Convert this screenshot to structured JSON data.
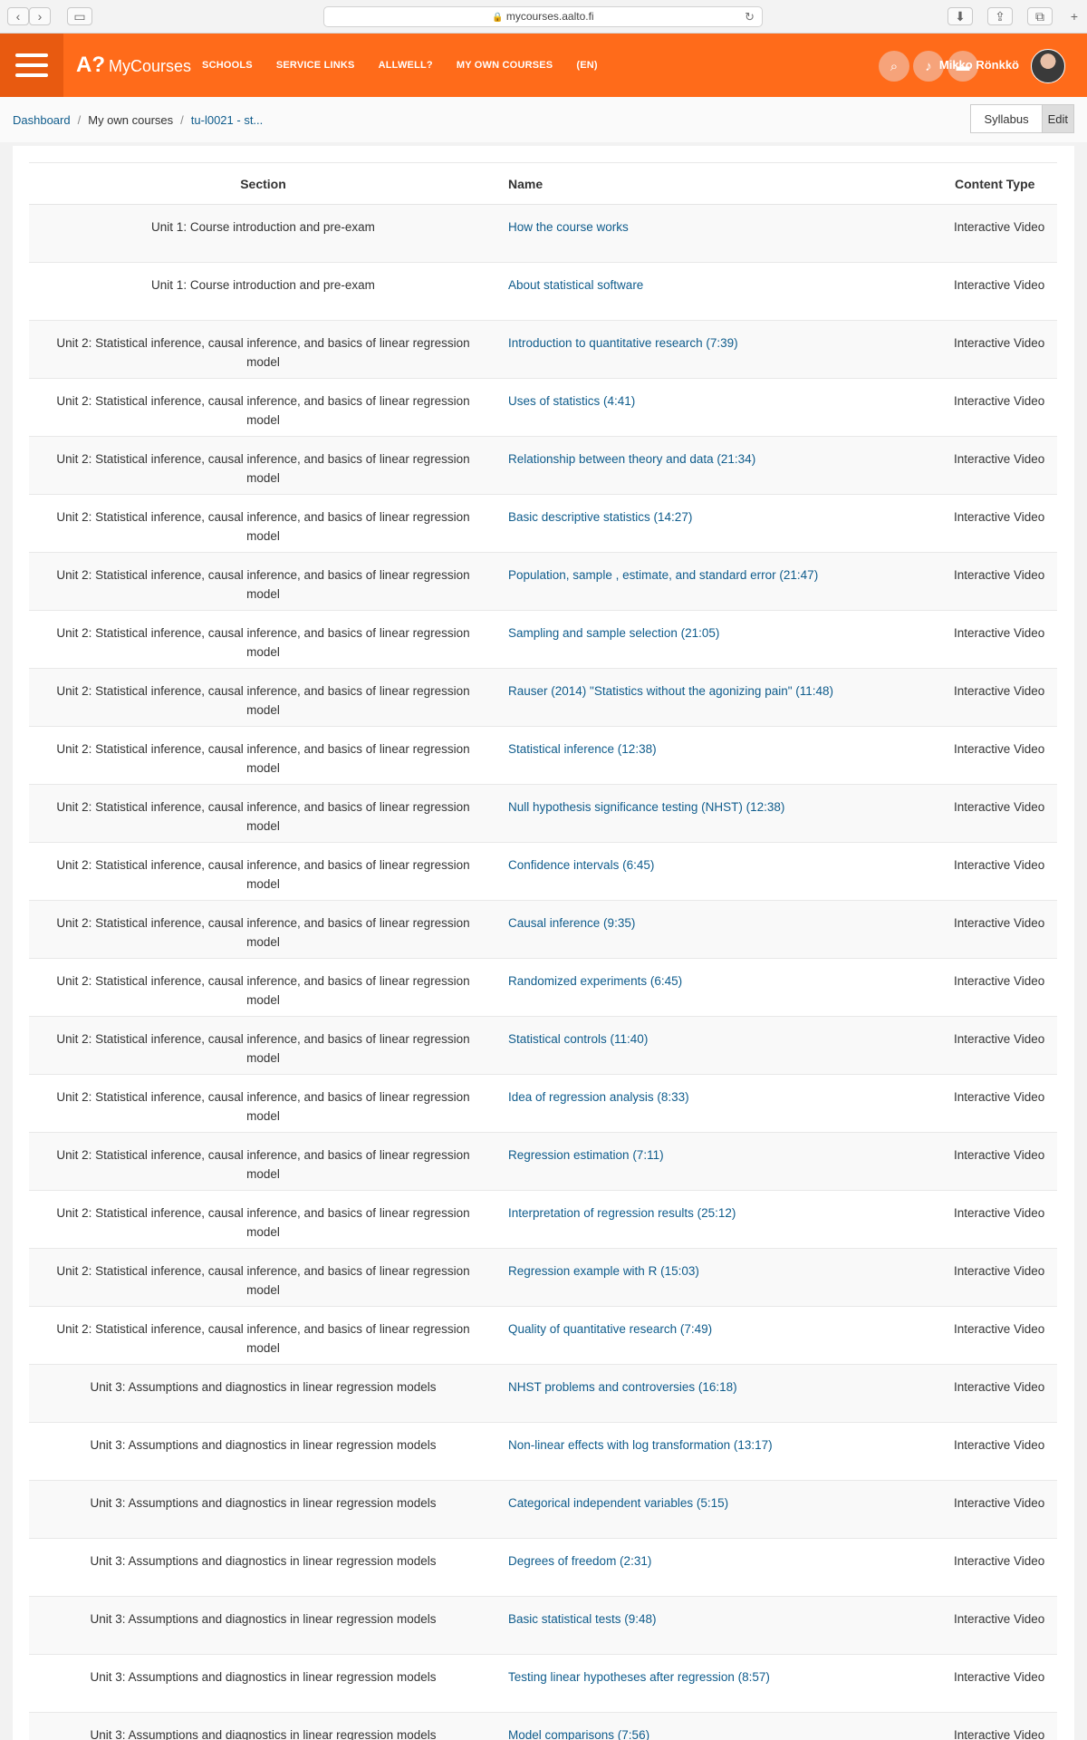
{
  "browser": {
    "url": "mycourses.aalto.fi"
  },
  "header": {
    "brand_mark": "A?",
    "brand_name": "MyCourses",
    "nav": [
      "SCHOOLS",
      "SERVICE LINKS",
      "ALLWELL?",
      "MY OWN COURSES",
      "(EN)"
    ],
    "user_name": "Mikko Rönkkö",
    "tool_icons": [
      "search-icon",
      "notification-icon",
      "messages-icon"
    ]
  },
  "breadcrumb": {
    "dashboard": "Dashboard",
    "sep1": "/",
    "my_courses": "My own courses",
    "sep2": "/",
    "course": "tu-l0021 - st..."
  },
  "actions": {
    "syllabus": "Syllabus",
    "edit": "Edit"
  },
  "table": {
    "headers": {
      "section": "Section",
      "name": "Name",
      "type": "Content Type"
    },
    "rows": [
      {
        "section": "Unit 1: Course introduction and pre-exam",
        "name": "How the course works",
        "type": "Interactive Video"
      },
      {
        "section": "Unit 1: Course introduction and pre-exam",
        "name": "About statistical software",
        "type": "Interactive Video"
      },
      {
        "section": "Unit 2: Statistical inference, causal inference, and basics of linear regression model",
        "name": "Introduction to quantitative research (7:39)",
        "type": "Interactive Video"
      },
      {
        "section": "Unit 2: Statistical inference, causal inference, and basics of linear regression model",
        "name": "Uses of statistics (4:41)",
        "type": "Interactive Video"
      },
      {
        "section": "Unit 2: Statistical inference, causal inference, and basics of linear regression model",
        "name": "Relationship between theory and data (21:34)",
        "type": "Interactive Video"
      },
      {
        "section": "Unit 2: Statistical inference, causal inference, and basics of linear regression model",
        "name": "Basic descriptive statistics (14:27)",
        "type": "Interactive Video"
      },
      {
        "section": "Unit 2: Statistical inference, causal inference, and basics of linear regression model",
        "name": "Population, sample , estimate, and standard error (21:47)",
        "type": "Interactive Video"
      },
      {
        "section": "Unit 2: Statistical inference, causal inference, and basics of linear regression model",
        "name": "Sampling and sample selection (21:05)",
        "type": "Interactive Video"
      },
      {
        "section": "Unit 2: Statistical inference, causal inference, and basics of linear regression model",
        "name": "Rauser (2014) \"Statistics without the agonizing pain\" (11:48)",
        "type": "Interactive Video"
      },
      {
        "section": "Unit 2: Statistical inference, causal inference, and basics of linear regression model",
        "name": "Statistical inference (12:38)",
        "type": "Interactive Video"
      },
      {
        "section": "Unit 2: Statistical inference, causal inference, and basics of linear regression model",
        "name": "Null hypothesis significance testing (NHST) (12:38)",
        "type": "Interactive Video"
      },
      {
        "section": "Unit 2: Statistical inference, causal inference, and basics of linear regression model",
        "name": "Confidence intervals (6:45)",
        "type": "Interactive Video"
      },
      {
        "section": "Unit 2: Statistical inference, causal inference, and basics of linear regression model",
        "name": "Causal inference (9:35)",
        "type": "Interactive Video"
      },
      {
        "section": "Unit 2: Statistical inference, causal inference, and basics of linear regression model",
        "name": "Randomized experiments (6:45)",
        "type": "Interactive Video"
      },
      {
        "section": "Unit 2: Statistical inference, causal inference, and basics of linear regression model",
        "name": "Statistical controls (11:40)",
        "type": "Interactive Video"
      },
      {
        "section": "Unit 2: Statistical inference, causal inference, and basics of linear regression model",
        "name": "Idea of regression analysis (8:33)",
        "type": "Interactive Video"
      },
      {
        "section": "Unit 2: Statistical inference, causal inference, and basics of linear regression model",
        "name": "Regression estimation (7:11)",
        "type": "Interactive Video"
      },
      {
        "section": "Unit 2: Statistical inference, causal inference, and basics of linear regression model",
        "name": "Interpretation of regression results (25:12)",
        "type": "Interactive Video"
      },
      {
        "section": "Unit 2: Statistical inference, causal inference, and basics of linear regression model",
        "name": "Regression example with R (15:03)",
        "type": "Interactive Video"
      },
      {
        "section": "Unit 2: Statistical inference, causal inference, and basics of linear regression model",
        "name": "Quality of quantitative research (7:49)",
        "type": "Interactive Video"
      },
      {
        "section": "Unit 3: Assumptions and diagnostics in linear regression models",
        "name": "NHST problems and controversies (16:18)",
        "type": "Interactive Video"
      },
      {
        "section": "Unit 3: Assumptions and diagnostics in linear regression models",
        "name": "Non-linear effects with log transformation (13:17)",
        "type": "Interactive Video"
      },
      {
        "section": "Unit 3: Assumptions and diagnostics in linear regression models",
        "name": "Categorical independent variables (5:15)",
        "type": "Interactive Video"
      },
      {
        "section": "Unit 3: Assumptions and diagnostics in linear regression models",
        "name": "Degrees of freedom (2:31)",
        "type": "Interactive Video"
      },
      {
        "section": "Unit 3: Assumptions and diagnostics in linear regression models",
        "name": "Basic statistical tests (9:48)",
        "type": "Interactive Video"
      },
      {
        "section": "Unit 3: Assumptions and diagnostics in linear regression models",
        "name": "Testing linear hypotheses after regression (8:57)",
        "type": "Interactive Video"
      },
      {
        "section": "Unit 3: Assumptions and diagnostics in linear regression models",
        "name": "Model comparisons (7:56)",
        "type": "Interactive Video"
      }
    ]
  }
}
